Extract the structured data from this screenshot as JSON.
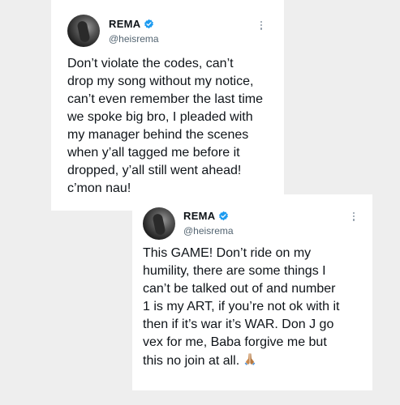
{
  "tweets": [
    {
      "name": "REMA",
      "handle": "@heisrema",
      "text": "Don’t violate the codes, can’t\ndrop my song without my notice,\ncan’t even remember the last time\nwe spoke big bro, I pleaded with\nmy manager behind the scenes\nwhen y’all tagged me before it\ndropped, y’all still went ahead!\nc’mon nau!",
      "avatar_icon": "profile-avatar",
      "verified_icon": "verified-badge-icon"
    },
    {
      "name": "REMA",
      "handle": "@heisrema",
      "text": "This GAME! Don’t ride on my\nhumility, there are some things I\ncan’t be talked out of and number\n1 is my ART, if you’re not ok with it\nthen if it’s war it’s WAR. Don J go\nvex for me, Baba forgive me but\nthis no join at all.",
      "emoji_icon": "folded-hands-icon",
      "avatar_icon": "profile-avatar",
      "verified_icon": "verified-badge-icon"
    }
  ],
  "colors": {
    "verified": "#1d9bf0",
    "text": "#0f1419",
    "muted": "#536471",
    "background": "#eeeeee"
  }
}
